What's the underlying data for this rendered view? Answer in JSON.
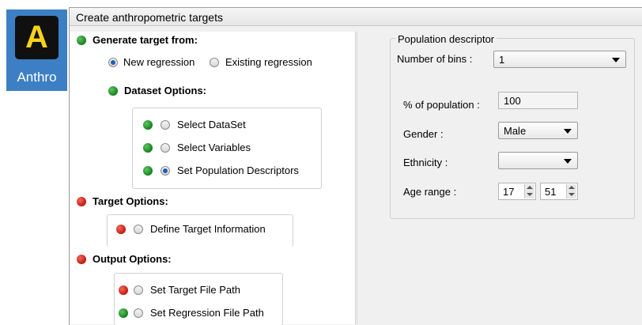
{
  "app_tile": {
    "logo_letter": "A",
    "label": "Anthro",
    "tile_color": "#3d7fc4",
    "logo_color": "#f7d21a"
  },
  "window": {
    "title": "Create anthropometric targets"
  },
  "left": {
    "generate_heading": "Generate target from:",
    "generate_status": "green",
    "regression_options": [
      {
        "label": "New regression",
        "checked": true
      },
      {
        "label": "Existing regression",
        "checked": false
      }
    ],
    "dataset_heading": "Dataset Options:",
    "dataset_status": "green",
    "dataset_items": [
      {
        "label": "Select DataSet",
        "status": "green",
        "checked": false
      },
      {
        "label": "Select Variables",
        "status": "green",
        "checked": false
      },
      {
        "label": "Set Population Descriptors",
        "status": "green",
        "checked": true
      }
    ],
    "target_heading": "Target Options:",
    "target_status": "red",
    "target_items": [
      {
        "label": "Define Target Information",
        "status": "red",
        "checked": false
      }
    ],
    "output_heading": "Output Options:",
    "output_status": "red",
    "output_items": [
      {
        "label": "Set Target File Path",
        "status": "red",
        "checked": false
      },
      {
        "label": "Set Regression File Path",
        "status": "green",
        "checked": false
      }
    ]
  },
  "right": {
    "group_title": "Population descriptor",
    "bins_label": "Number of bins :",
    "bins_value": "1",
    "pct_label": "% of population :",
    "pct_value": "100",
    "gender_label": "Gender :",
    "gender_value": "Male",
    "ethnicity_label": "Ethnicity :",
    "ethnicity_value": "",
    "age_label": "Age range :",
    "age_min": "17",
    "age_max": "51"
  },
  "colors": {
    "status_green": "#12821b",
    "status_red": "#c21a10",
    "radio_selected": "#1e5fb3"
  }
}
